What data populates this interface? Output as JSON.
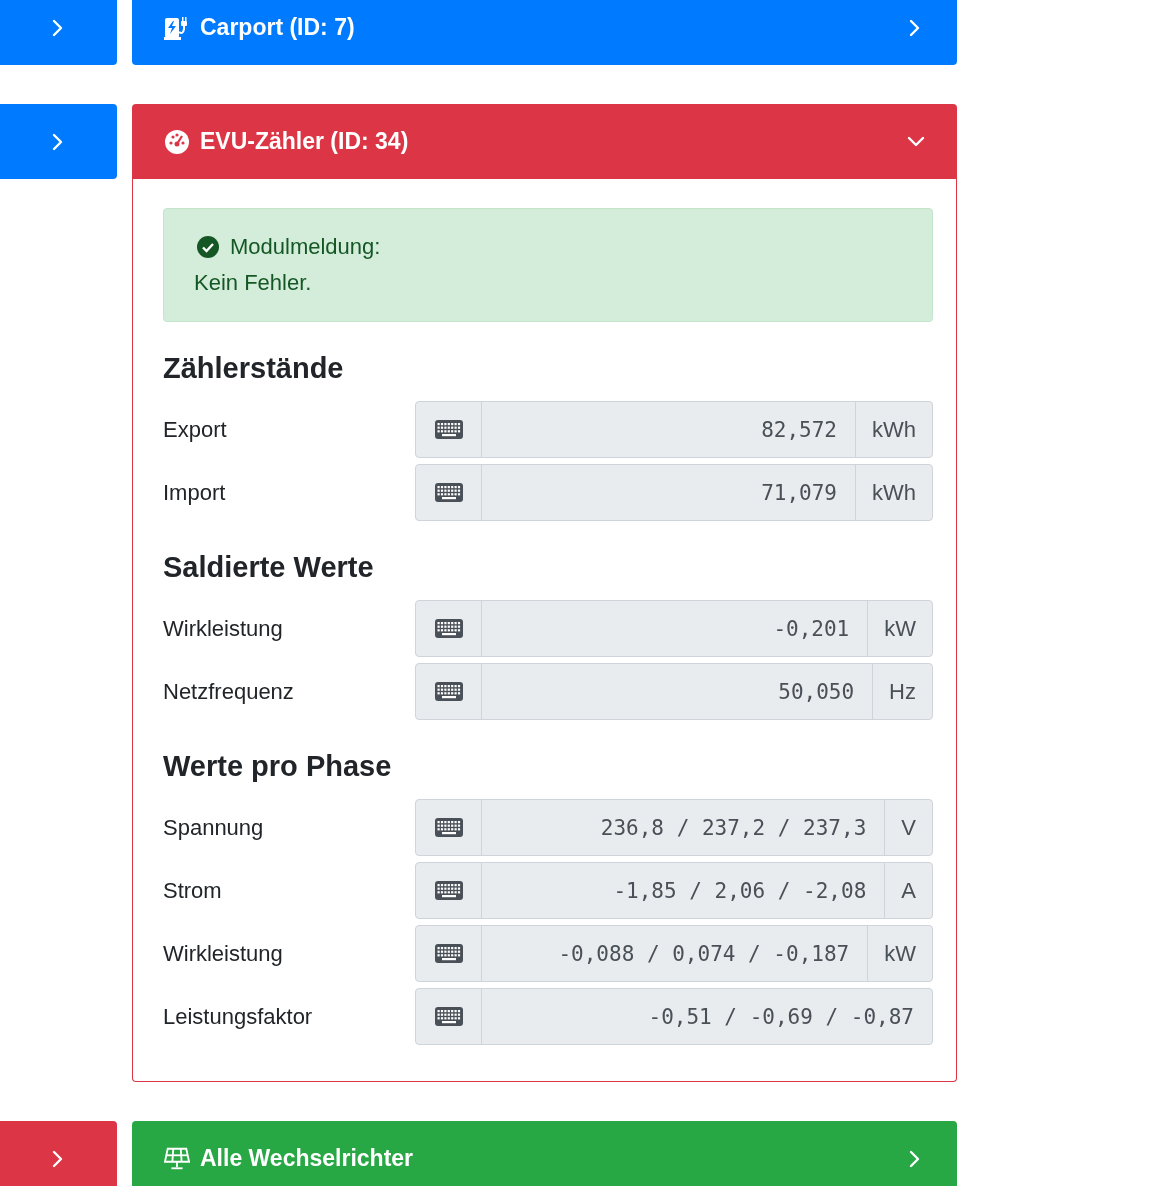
{
  "devices": [
    {
      "toggle": {
        "color": "#007bff"
      },
      "color": "#007bff",
      "kind": "charger",
      "title": "Carport (ID: 7)",
      "expanded": false
    },
    {
      "toggle": {
        "color": "#007bff"
      },
      "color": "#dc3545",
      "kind": "gauge",
      "title": "EVU-Zähler (ID: 34)",
      "expanded": true,
      "alert": {
        "title": "Modulmeldung:",
        "message": "Kein Fehler."
      },
      "sections": [
        {
          "heading": "Zählerstände",
          "rows": [
            {
              "label": "Export",
              "value": "82,572",
              "unit": "kWh"
            },
            {
              "label": "Import",
              "value": "71,079",
              "unit": "kWh"
            }
          ]
        },
        {
          "heading": "Saldierte Werte",
          "rows": [
            {
              "label": "Wirkleistung",
              "value": "-0,201",
              "unit": "kW"
            },
            {
              "label": "Netzfrequenz",
              "value": "50,050",
              "unit": "Hz"
            }
          ]
        },
        {
          "heading": "Werte pro Phase",
          "rows": [
            {
              "label": "Spannung",
              "value": "236,8 / 237,2 / 237,3",
              "unit": "V"
            },
            {
              "label": "Strom",
              "value": "-1,85 / 2,06 / -2,08",
              "unit": "A"
            },
            {
              "label": "Wirkleistung",
              "value": "-0,088 / 0,074 / -0,187",
              "unit": "kW"
            },
            {
              "label": "Leistungsfaktor",
              "value": "-0,51 / -0,69 / -0,87"
            }
          ]
        }
      ]
    },
    {
      "toggle": {
        "color": "#dc3545"
      },
      "color": "#28a745",
      "kind": "solar",
      "title": "Alle Wechselrichter",
      "expanded": false
    }
  ]
}
